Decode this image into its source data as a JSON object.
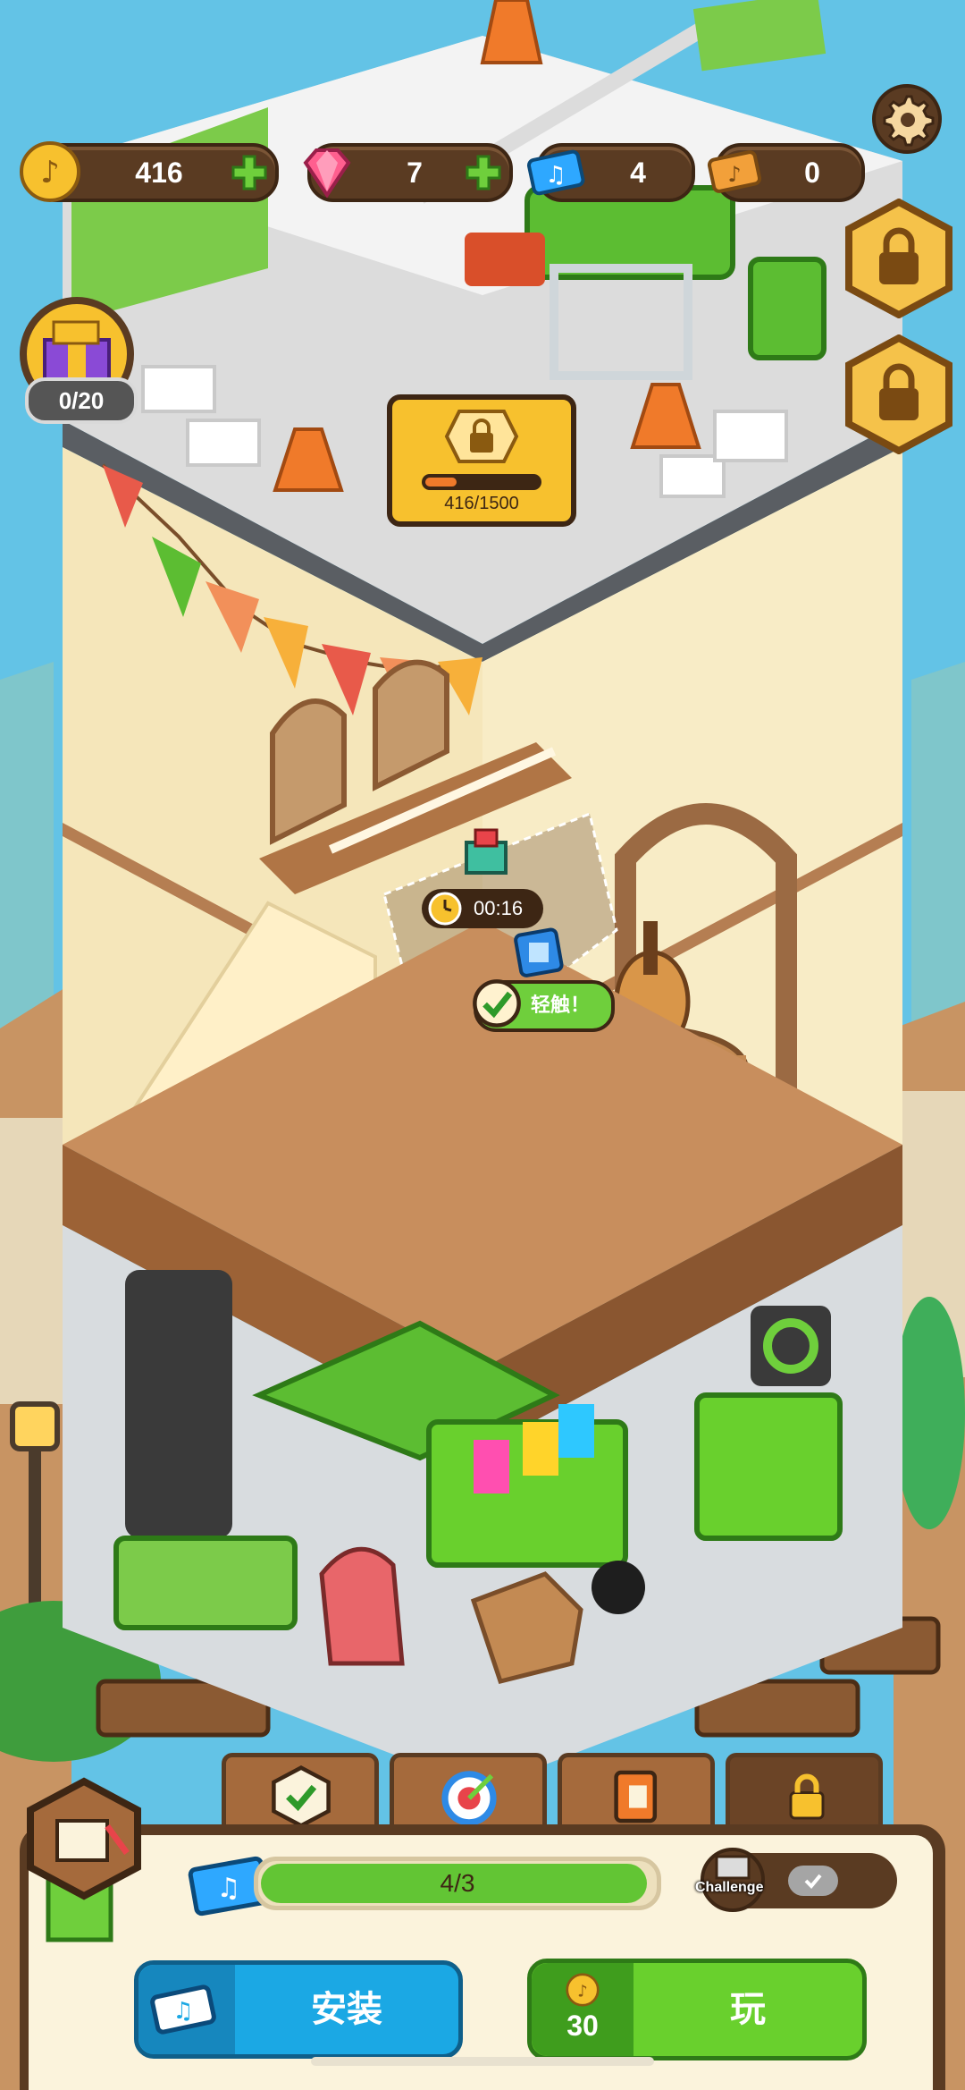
{
  "resources": {
    "coins": "416",
    "gems": "7",
    "tickets": "4",
    "golden_tickets": "0"
  },
  "gift": {
    "count": "0/20"
  },
  "construction": {
    "progress_text": "416/1500",
    "progress_fraction": 0.277
  },
  "floor2": {
    "timer": "00:16",
    "tap_label": "轻触！"
  },
  "bottom": {
    "progress_text": "4/3",
    "progress_fraction": 1.0,
    "challenge_label": "Challenge",
    "install_label": "安装",
    "play_label": "玩",
    "play_cost": "30"
  },
  "colors": {
    "sky": "#63c3e6",
    "accent_green": "#69d02d",
    "accent_blue": "#1ba8e4",
    "brown": "#5a3b22"
  }
}
